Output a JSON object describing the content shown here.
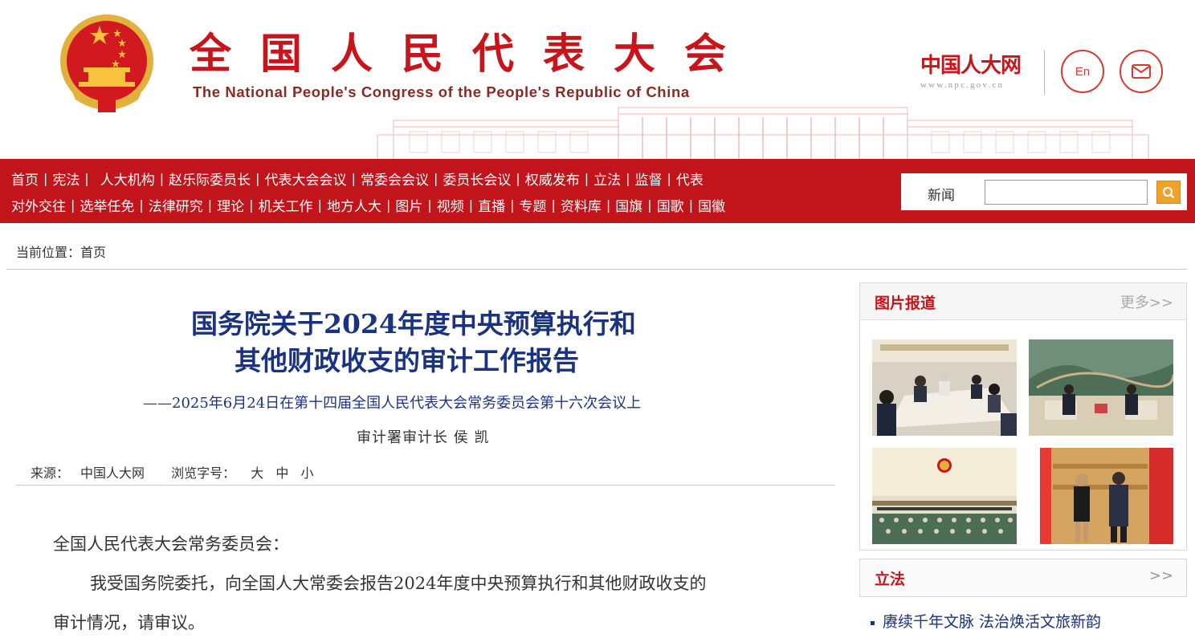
{
  "header": {
    "title_cn": "全国人民代表大会",
    "title_en": "The National People's Congress of the People's Republic of China",
    "logo_cn": "中国人大网",
    "logo_url": "www.npc.gov.cn",
    "en_button": "En",
    "mail_icon": "mail-icon"
  },
  "nav": {
    "row1": [
      "首页",
      "宪法",
      "人大机构",
      "赵乐际委员长",
      "代表大会会议",
      "常委会会议",
      "委员长会议",
      "权威发布",
      "立法",
      "监督",
      "代表"
    ],
    "row2": [
      "对外交往",
      "选举任免",
      "法律研究",
      "理论",
      "机关工作",
      "地方人大",
      "图片",
      "视频",
      "直播",
      "专题",
      "资料库",
      "国旗",
      "国歌",
      "国徽"
    ],
    "separator": "|"
  },
  "search": {
    "label": "新闻",
    "placeholder": "",
    "button_icon": "search-icon"
  },
  "breadcrumb": {
    "prefix": "当前位置：",
    "home": "首页"
  },
  "article": {
    "title_line1": "国务院关于2024年度中央预算执行和",
    "title_line2": "其他财政收支的审计工作报告",
    "subtitle": "——2025年6月24日在第十四届全国人民代表大会常务委员会第十六次会议上",
    "author": "审计署审计长 侯 凯",
    "source_label": "来源：",
    "source": "中国人大网",
    "font_label": "浏览字号：",
    "font_sizes": [
      "大",
      "中",
      "小"
    ],
    "salutation": "全国人民代表大会常务委员会：",
    "para1_line1": "我受国务院委托，向全国人大常委会报告2024年度中央预算执行和其他财政收支的",
    "para1_line2": "审计情况，请审议。"
  },
  "sidebar": {
    "photo_title": "图片报道",
    "more": "更多>>",
    "photos": [
      "photo-meeting-table",
      "photo-great-wall-meeting",
      "photo-plenary-hall",
      "photo-diplomatic-handshake"
    ],
    "law_title": "立法",
    "law_more": ">>",
    "law_items": [
      "赓续千年文脉 法治焕活文旅新韵"
    ]
  },
  "colors": {
    "brand_red": "#c1141b",
    "title_blue": "#1a3380",
    "search_orange": "#f1a02a"
  }
}
